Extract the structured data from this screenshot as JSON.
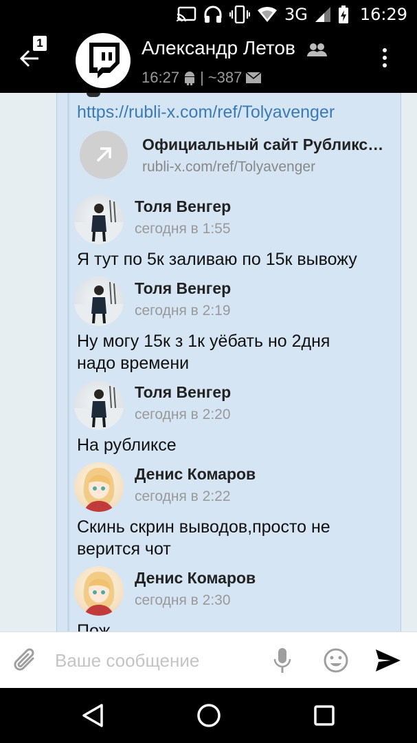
{
  "status_bar": {
    "network": "3G",
    "time": "16:29",
    "icons": [
      "cast-icon",
      "headphones-icon",
      "vibrate-icon",
      "wifi-icon",
      "signal-icon",
      "battery-charging-icon"
    ]
  },
  "header": {
    "title": "Александр Летов",
    "subtitle_time": "16:27",
    "subtitle_sep": "|",
    "subtitle_count": "~387",
    "back_badge": "1"
  },
  "forwarded": {
    "link_text": "https://rubli-x.com/ref/Tolyavenger",
    "card_title": "Официальный сайт Рубликс…",
    "card_url": "rubli-x.com/ref/Tolyavenger"
  },
  "messages": [
    {
      "author": "Толя Венгер",
      "time": "сегодня в 1:55",
      "text": "Я тут по 5к заливаю по 15к вывожу",
      "avatar": "boy"
    },
    {
      "author": "Толя Венгер",
      "time": "сегодня в 2:19",
      "text": "Ну могу 15к з 1к уёбать но 2дня надо времени",
      "avatar": "boy"
    },
    {
      "author": "Толя Венгер",
      "time": "сегодня в 2:20",
      "text": "На рубликсе",
      "avatar": "boy"
    },
    {
      "author": "Денис Комаров",
      "time": "сегодня в 2:22",
      "text": "Скинь скрин выводов,просто не верится чот",
      "avatar": "girl"
    },
    {
      "author": "Денис Комаров",
      "time": "сегодня в 2:30",
      "text": "Пож…",
      "avatar": "girl"
    }
  ],
  "input": {
    "placeholder": "Ваше сообщение"
  },
  "colors": {
    "link": "#3a7bb5",
    "forward_bg": "#d6e5f3",
    "chat_bg": "#e6eef2"
  }
}
